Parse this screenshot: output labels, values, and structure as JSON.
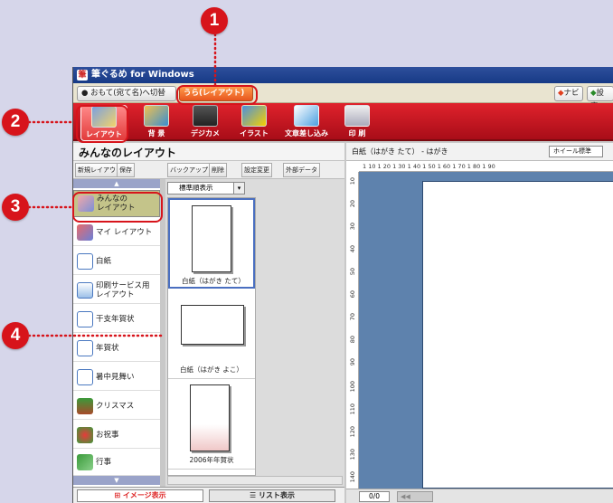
{
  "window": {
    "title": "筆ぐるめ for Windows"
  },
  "mode": {
    "front_label": "おもて(宛て名)へ切替",
    "back_label": "うら(レイアウト)",
    "navi_label": "ナビ",
    "settings_label": "設定"
  },
  "toolbar": {
    "items": [
      {
        "label": "レイアウト"
      },
      {
        "label": "背 景"
      },
      {
        "label": "デジカメ"
      },
      {
        "label": "イラスト"
      },
      {
        "label": "文章差し込み"
      },
      {
        "label": "印 刷"
      }
    ]
  },
  "left_panel": {
    "title": "みんなのレイアウト",
    "tools": [
      "新規レイアウト",
      "保存",
      "バックアップ",
      "削除",
      "設定変更",
      "外部データ"
    ],
    "categories": [
      {
        "label": "みんなの\nレイアウト"
      },
      {
        "label": "マイ レイアウト"
      },
      {
        "label": "白紙"
      },
      {
        "label": "印刷サービス用\nレイアウト"
      },
      {
        "label": "干支年賀状"
      },
      {
        "label": "年賀状"
      },
      {
        "label": "暑中見舞い"
      },
      {
        "label": "クリスマス"
      },
      {
        "label": "お祝事"
      },
      {
        "label": "行事"
      }
    ],
    "view_select": "標準順表示",
    "thumbnails": [
      {
        "caption": "白紙（はがき たて）"
      },
      {
        "caption": "白紙（はがき よこ）"
      },
      {
        "caption": "2006年年賀状"
      }
    ],
    "tabs": {
      "image_view": "イメージ表示",
      "list_view": "リスト表示"
    }
  },
  "right_panel": {
    "header": "白紙（はがき たて） - はがき",
    "zoom": "ホイール標準",
    "ruler_h": "1 10 1 20 1 30 1 40 1 50 1 60 1 70 1 80 1 90",
    "ruler_v": [
      "10",
      "20",
      "30",
      "40",
      "50",
      "60",
      "70",
      "80",
      "90",
      "100",
      "110",
      "120",
      "130",
      "140"
    ],
    "page_count": "0/0"
  },
  "callouts": [
    "1",
    "2",
    "3",
    "4"
  ],
  "colors": {
    "accent": "#d7141b",
    "toolbar": "#c8131e",
    "canvas": "#5e82ad"
  }
}
